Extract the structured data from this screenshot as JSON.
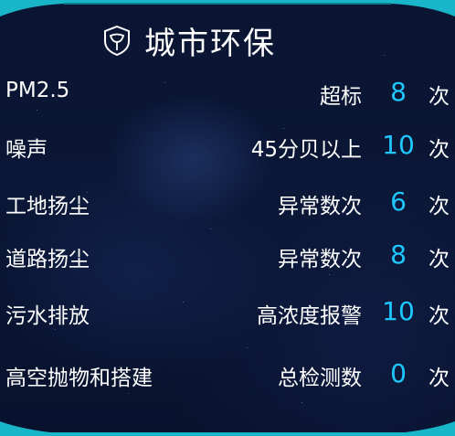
{
  "title": "城市环保",
  "logo_icon": "leaf-shield-icon",
  "colors": {
    "value": "#1ec8ff",
    "accent": "#19b5c8",
    "text": "#ffffff",
    "background": "#0a1533"
  },
  "rows": [
    {
      "label": "PM2.5",
      "metric": "超标",
      "value": "8",
      "unit": "次"
    },
    {
      "label": "噪声",
      "metric": "45分贝以上",
      "value": "10",
      "unit": "次"
    },
    {
      "label": "工地扬尘",
      "metric": "异常数次",
      "value": "6",
      "unit": "次"
    },
    {
      "label": "道路扬尘",
      "metric": "异常数次",
      "value": "8",
      "unit": "次"
    },
    {
      "label": "污水排放",
      "metric": "高浓度报警",
      "value": "10",
      "unit": "次"
    },
    {
      "label": "高空抛物和搭建",
      "metric": "总检测数",
      "value": "0",
      "unit": "次"
    }
  ]
}
